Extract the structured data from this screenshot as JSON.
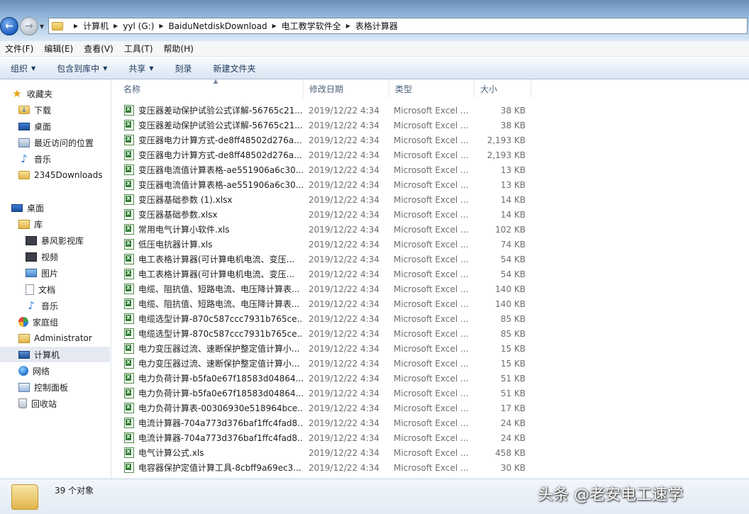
{
  "address": {
    "breadcrumbs": [
      "计算机",
      "yyl (G:)",
      "BaiduNetdiskDownload",
      "电工教学软件全",
      "表格计算器"
    ]
  },
  "menu": [
    "文件(F)",
    "编辑(E)",
    "查看(V)",
    "工具(T)",
    "帮助(H)"
  ],
  "toolbar": {
    "organize": "组织",
    "include_library": "包含到库中",
    "share": "共享",
    "burn": "刻录",
    "new_folder": "新建文件夹"
  },
  "nav": {
    "favorites": "收藏夹",
    "downloads": "下载",
    "desktop_fav": "桌面",
    "recent": "最近访问的位置",
    "music_fav": "音乐",
    "dl2345": "2345Downloads",
    "desktop": "桌面",
    "libraries": "库",
    "storm": "暴风影视库",
    "videos": "视频",
    "pictures": "图片",
    "documents": "文档",
    "music": "音乐",
    "homegroup": "家庭组",
    "admin": "Administrator",
    "computer": "计算机",
    "network": "网络",
    "control_panel": "控制面板",
    "recycle": "回收站"
  },
  "columns": {
    "name": "名称",
    "date": "修改日期",
    "type": "类型",
    "size": "大小"
  },
  "files": [
    {
      "name": "变压器差动保护试验公式详解-56765c21...",
      "date": "2019/12/22 4:34",
      "type": "Microsoft Excel ...",
      "size": "38 KB"
    },
    {
      "name": "变压器差动保护试验公式详解-56765c21...",
      "date": "2019/12/22 4:34",
      "type": "Microsoft Excel ...",
      "size": "38 KB"
    },
    {
      "name": "变压器电力计算方式-de8ff48502d276a...",
      "date": "2019/12/22 4:34",
      "type": "Microsoft Excel ...",
      "size": "2,193 KB"
    },
    {
      "name": "变压器电力计算方式-de8ff48502d276a...",
      "date": "2019/12/22 4:34",
      "type": "Microsoft Excel ...",
      "size": "2,193 KB"
    },
    {
      "name": "变压器电流值计算表格-ae551906a6c30...",
      "date": "2019/12/22 4:34",
      "type": "Microsoft Excel ...",
      "size": "13 KB"
    },
    {
      "name": "变压器电流值计算表格-ae551906a6c30...",
      "date": "2019/12/22 4:34",
      "type": "Microsoft Excel ...",
      "size": "13 KB"
    },
    {
      "name": "变压器基础参数 (1).xlsx",
      "date": "2019/12/22 4:34",
      "type": "Microsoft Excel ...",
      "size": "14 KB"
    },
    {
      "name": "变压器基础参数.xlsx",
      "date": "2019/12/22 4:34",
      "type": "Microsoft Excel ...",
      "size": "14 KB"
    },
    {
      "name": "常用电气计算小软件.xls",
      "date": "2019/12/22 4:34",
      "type": "Microsoft Excel ...",
      "size": "102 KB"
    },
    {
      "name": "低压电抗器计算.xls",
      "date": "2019/12/22 4:34",
      "type": "Microsoft Excel ...",
      "size": "74 KB"
    },
    {
      "name": "电工表格计算器(可计算电机电流、变压...",
      "date": "2019/12/22 4:34",
      "type": "Microsoft Excel ...",
      "size": "54 KB"
    },
    {
      "name": "电工表格计算器(可计算电机电流、变压...",
      "date": "2019/12/22 4:34",
      "type": "Microsoft Excel ...",
      "size": "54 KB"
    },
    {
      "name": "电缆、阻抗值、短路电流、电压降计算表...",
      "date": "2019/12/22 4:34",
      "type": "Microsoft Excel ...",
      "size": "140 KB"
    },
    {
      "name": "电缆、阻抗值、短路电流、电压降计算表...",
      "date": "2019/12/22 4:34",
      "type": "Microsoft Excel ...",
      "size": "140 KB"
    },
    {
      "name": "电缆选型计算-870c587ccc7931b765ce...",
      "date": "2019/12/22 4:34",
      "type": "Microsoft Excel ...",
      "size": "85 KB"
    },
    {
      "name": "电缆选型计算-870c587ccc7931b765ce...",
      "date": "2019/12/22 4:34",
      "type": "Microsoft Excel ...",
      "size": "85 KB"
    },
    {
      "name": "电力变压器过流、速断保护整定值计算小...",
      "date": "2019/12/22 4:34",
      "type": "Microsoft Excel ...",
      "size": "15 KB"
    },
    {
      "name": "电力变压器过流、速断保护整定值计算小...",
      "date": "2019/12/22 4:34",
      "type": "Microsoft Excel ...",
      "size": "15 KB"
    },
    {
      "name": "电力负荷计算-b5fa0e67f18583d04864...",
      "date": "2019/12/22 4:34",
      "type": "Microsoft Excel ...",
      "size": "51 KB"
    },
    {
      "name": "电力负荷计算-b5fa0e67f18583d04864...",
      "date": "2019/12/22 4:34",
      "type": "Microsoft Excel ...",
      "size": "51 KB"
    },
    {
      "name": "电力负荷计算表-00306930e518964bce...",
      "date": "2019/12/22 4:34",
      "type": "Microsoft Excel ...",
      "size": "17 KB"
    },
    {
      "name": "电流计算器-704a773d376baf1ffc4fad8...",
      "date": "2019/12/22 4:34",
      "type": "Microsoft Excel ...",
      "size": "24 KB"
    },
    {
      "name": "电流计算器-704a773d376baf1ffc4fad8...",
      "date": "2019/12/22 4:34",
      "type": "Microsoft Excel ...",
      "size": "24 KB"
    },
    {
      "name": "电气计算公式.xls",
      "date": "2019/12/22 4:34",
      "type": "Microsoft Excel ...",
      "size": "458 KB"
    },
    {
      "name": "电容器保护定值计算工具-8cbff9a69ec3...",
      "date": "2019/12/22 4:34",
      "type": "Microsoft Excel ...",
      "size": "30 KB"
    }
  ],
  "status": {
    "count": "39 个对象"
  },
  "watermark": "头条 @老安电工速学",
  "icons": {
    "back": "back-arrow-icon",
    "forward": "forward-arrow-icon",
    "file": "excel-file-icon"
  }
}
